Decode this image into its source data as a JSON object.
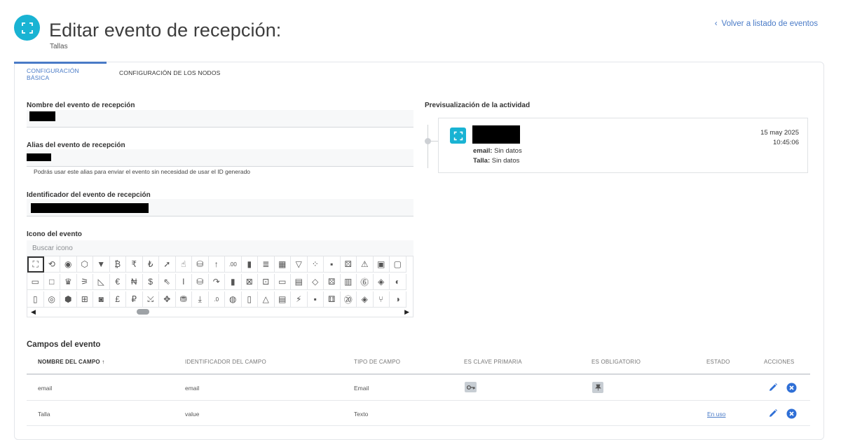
{
  "header": {
    "title": "Editar evento de recepción:",
    "subtitle": "Tallas",
    "back_link": "Volver a listado de eventos",
    "icon": "expand-corners-icon",
    "accent_color": "#19b3d3"
  },
  "tabs": [
    {
      "label": "CONFIGURACIÓN BÁSICA",
      "active": true
    },
    {
      "label": "CONFIGURACIÓN DE LOS NODOS",
      "active": false
    }
  ],
  "form": {
    "name_label": "Nombre del evento de recepción",
    "alias_label": "Alias del evento de recepción",
    "alias_help": "Podrás usar este alias para enviar el evento sin necesidad de usar el ID generado",
    "id_label": "Identificador del evento de recepción",
    "icon_label": "Icono del evento",
    "icon_search_placeholder": "Buscar icono"
  },
  "icon_grid": {
    "rows": [
      [
        "⛶",
        "⟲",
        "◉",
        "⬡",
        "▼",
        "₿",
        "₹",
        "₺",
        "➚",
        "☝",
        "⛁",
        "↑",
        ".00",
        "▮",
        "≣",
        "▦",
        "▽",
        "⁘",
        "▪",
        "⚄",
        "⚠",
        "▣",
        "▢"
      ],
      [
        "▭",
        "□",
        "♛",
        "⚞",
        "◺",
        "€",
        "₦",
        "$",
        "⇖",
        "I",
        "⛁",
        "↷",
        "▮",
        "⊠",
        "⊡",
        "▭",
        "▤",
        "◇",
        "⚄",
        "▥",
        "⓺",
        "◈",
        "◐"
      ],
      [
        "▯",
        "◎",
        "⬢",
        "⊞",
        "◙",
        "£",
        "₽",
        "⤩",
        "✥",
        "⛃",
        "⤓",
        ".0",
        "◍",
        "▯",
        "△",
        "▤",
        "⚡",
        "▪",
        "⚅",
        "⑳",
        "◈",
        "⑂",
        "◑"
      ]
    ],
    "selected": "expand-corners-icon"
  },
  "preview": {
    "label": "Previsualización de la actividad",
    "date": "15 may 2025",
    "time": "10:45:06",
    "email_key": "email:",
    "email_value": "Sin datos",
    "talla_key": "Talla:",
    "talla_value": "Sin datos"
  },
  "fields": {
    "section_title": "Campos del evento",
    "columns": [
      "NOMBRE DEL CAMPO",
      "IDENTIFICADOR DEL CAMPO",
      "TIPO DE CAMPO",
      "ES CLAVE PRIMARIA",
      "ES OBLIGATORIO",
      "ESTADO",
      "ACCIONES"
    ],
    "rows": [
      {
        "name": "email",
        "id": "value_email",
        "id_display": "email",
        "type": "Email",
        "primary": true,
        "required": true,
        "status": ""
      },
      {
        "name": "Talla",
        "id_display": "value",
        "type": "Texto",
        "primary": false,
        "required": false,
        "status": "En uso"
      }
    ]
  },
  "colors": {
    "link": "#4a7bc7",
    "action": "#2f6fd6",
    "badge": "#c7cdd3"
  }
}
